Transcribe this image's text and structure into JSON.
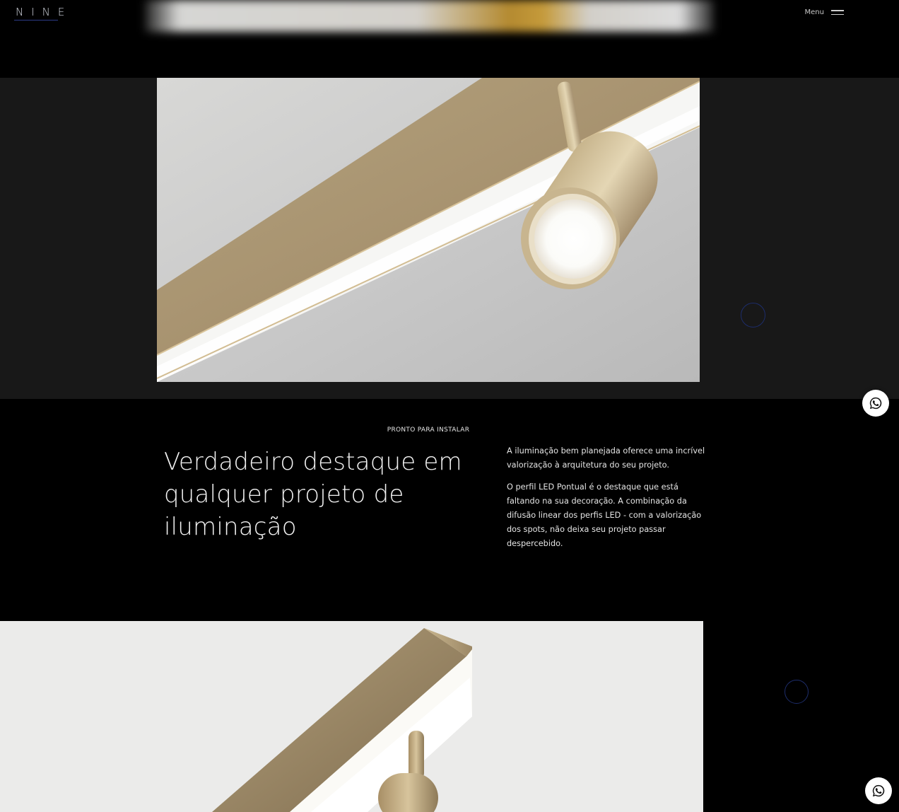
{
  "header": {
    "logo": "NINE",
    "menu_label": "Menu"
  },
  "gallery": {
    "caption": "PRONTO PARA INSTALAR"
  },
  "feature": {
    "headline": "Verdadeiro destaque em qualquer projeto de iluminação",
    "paragraph_1": "A iluminação bem planejada oferece uma incrível valorização à arquitetura do seu projeto.",
    "paragraph_2": "O perfil LED Pontual é o destaque que está faltando na sua decoração. A combinação da difusão linear dos perfis LED - com a valorização dos spots, não deixa seu projeto passar despercebido."
  },
  "icons": {
    "menu": "hamburger-icon",
    "whatsapp": "whatsapp-icon"
  },
  "colors": {
    "accent_gold": "#b8a27a",
    "logo_underline": "#2d3a86",
    "ring": "#1d2d6b"
  }
}
